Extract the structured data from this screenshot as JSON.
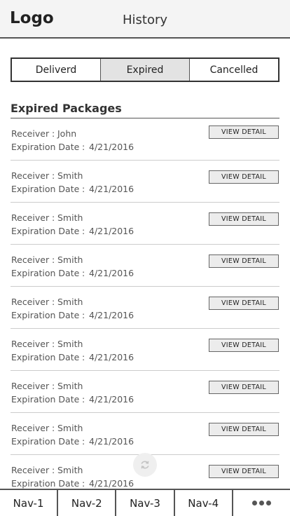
{
  "header": {
    "logo": "Logo",
    "title": "History"
  },
  "tabs": [
    {
      "label": "Deliverd",
      "active": false
    },
    {
      "label": "Expired",
      "active": true
    },
    {
      "label": "Cancelled",
      "active": false
    }
  ],
  "section": {
    "title": "Expired Packages"
  },
  "labels": {
    "receiver": "Receiver",
    "expiration": "Expiration Date",
    "separator": ":",
    "view_detail": "VIEW DETAIL"
  },
  "packages": [
    {
      "receiver": "John",
      "expiration": "4/21/2016"
    },
    {
      "receiver": "Smith",
      "expiration": "4/21/2016"
    },
    {
      "receiver": "Smith",
      "expiration": "4/21/2016"
    },
    {
      "receiver": "Smith",
      "expiration": "4/21/2016"
    },
    {
      "receiver": "Smith",
      "expiration": "4/21/2016"
    },
    {
      "receiver": "Smith",
      "expiration": "4/21/2016"
    },
    {
      "receiver": "Smith",
      "expiration": "4/21/2016"
    },
    {
      "receiver": "Smith",
      "expiration": "4/21/2016"
    },
    {
      "receiver": "Smith",
      "expiration": "4/21/2016"
    }
  ],
  "nav": [
    {
      "label": "Nav-1"
    },
    {
      "label": "Nav-2"
    },
    {
      "label": "Nav-3"
    },
    {
      "label": "Nav-4"
    }
  ],
  "icons": {
    "more": "more-dots-icon",
    "loading": "refresh-icon"
  }
}
